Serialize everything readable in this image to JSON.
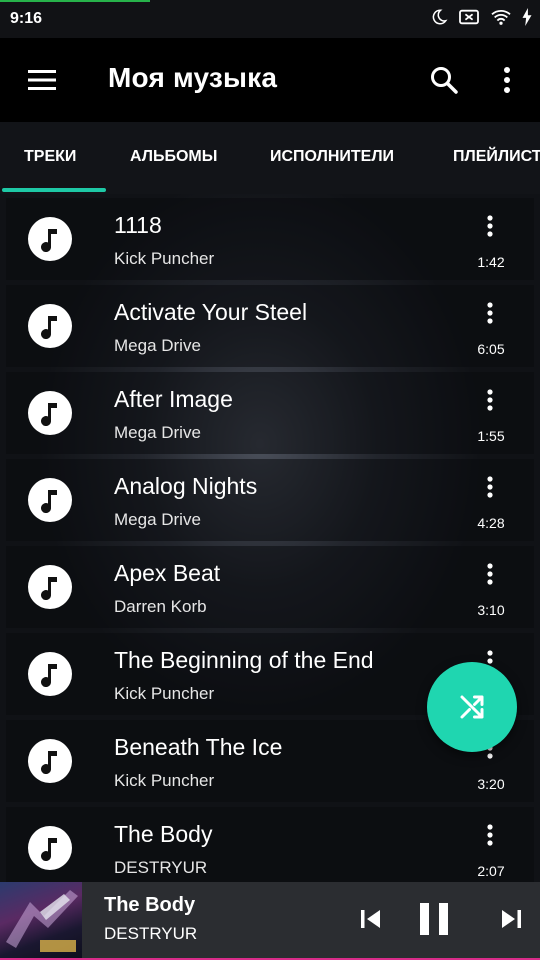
{
  "status_bar": {
    "time": "9:16",
    "icons": [
      "moon-icon",
      "battery-saver-icon",
      "wifi-icon",
      "charging-icon"
    ]
  },
  "app_bar": {
    "title": "Моя музыка",
    "icons": [
      "hamburger-menu-icon",
      "search-icon",
      "more-vertical-icon"
    ]
  },
  "tabs": [
    {
      "label": "ТРЕКИ",
      "selected": true
    },
    {
      "label": "АЛЬБОМЫ",
      "selected": false
    },
    {
      "label": "ИСПОЛНИТЕЛИ",
      "selected": false
    },
    {
      "label": "ПЛЕЙЛИСТЫ",
      "selected": false
    }
  ],
  "tracks": [
    {
      "title": "1118",
      "artist": "Kick Puncher",
      "duration": "1:42"
    },
    {
      "title": "Activate Your Steel",
      "artist": "Mega Drive",
      "duration": "6:05"
    },
    {
      "title": "After Image",
      "artist": "Mega Drive",
      "duration": "1:55"
    },
    {
      "title": "Analog Nights",
      "artist": "Mega Drive",
      "duration": "4:28"
    },
    {
      "title": "Apex Beat",
      "artist": "Darren Korb",
      "duration": "3:10"
    },
    {
      "title": "The Beginning of the End",
      "artist": "Kick Puncher",
      "duration": ""
    },
    {
      "title": "Beneath The Ice",
      "artist": "Kick Puncher",
      "duration": "3:20"
    },
    {
      "title": "The Body",
      "artist": "DESTRYUR",
      "duration": "2:07"
    }
  ],
  "fab": {
    "icon": "shuffle-icon"
  },
  "now_playing": {
    "title": "The Body",
    "artist": "DESTRYUR",
    "icons": [
      "skip-previous-icon",
      "pause-icon",
      "skip-next-icon"
    ]
  },
  "colors": {
    "accent": "#1ec9a6",
    "fab": "#1fd6b0",
    "player_bar": "#2b2d31",
    "progress_pink": "#d92c8a"
  }
}
